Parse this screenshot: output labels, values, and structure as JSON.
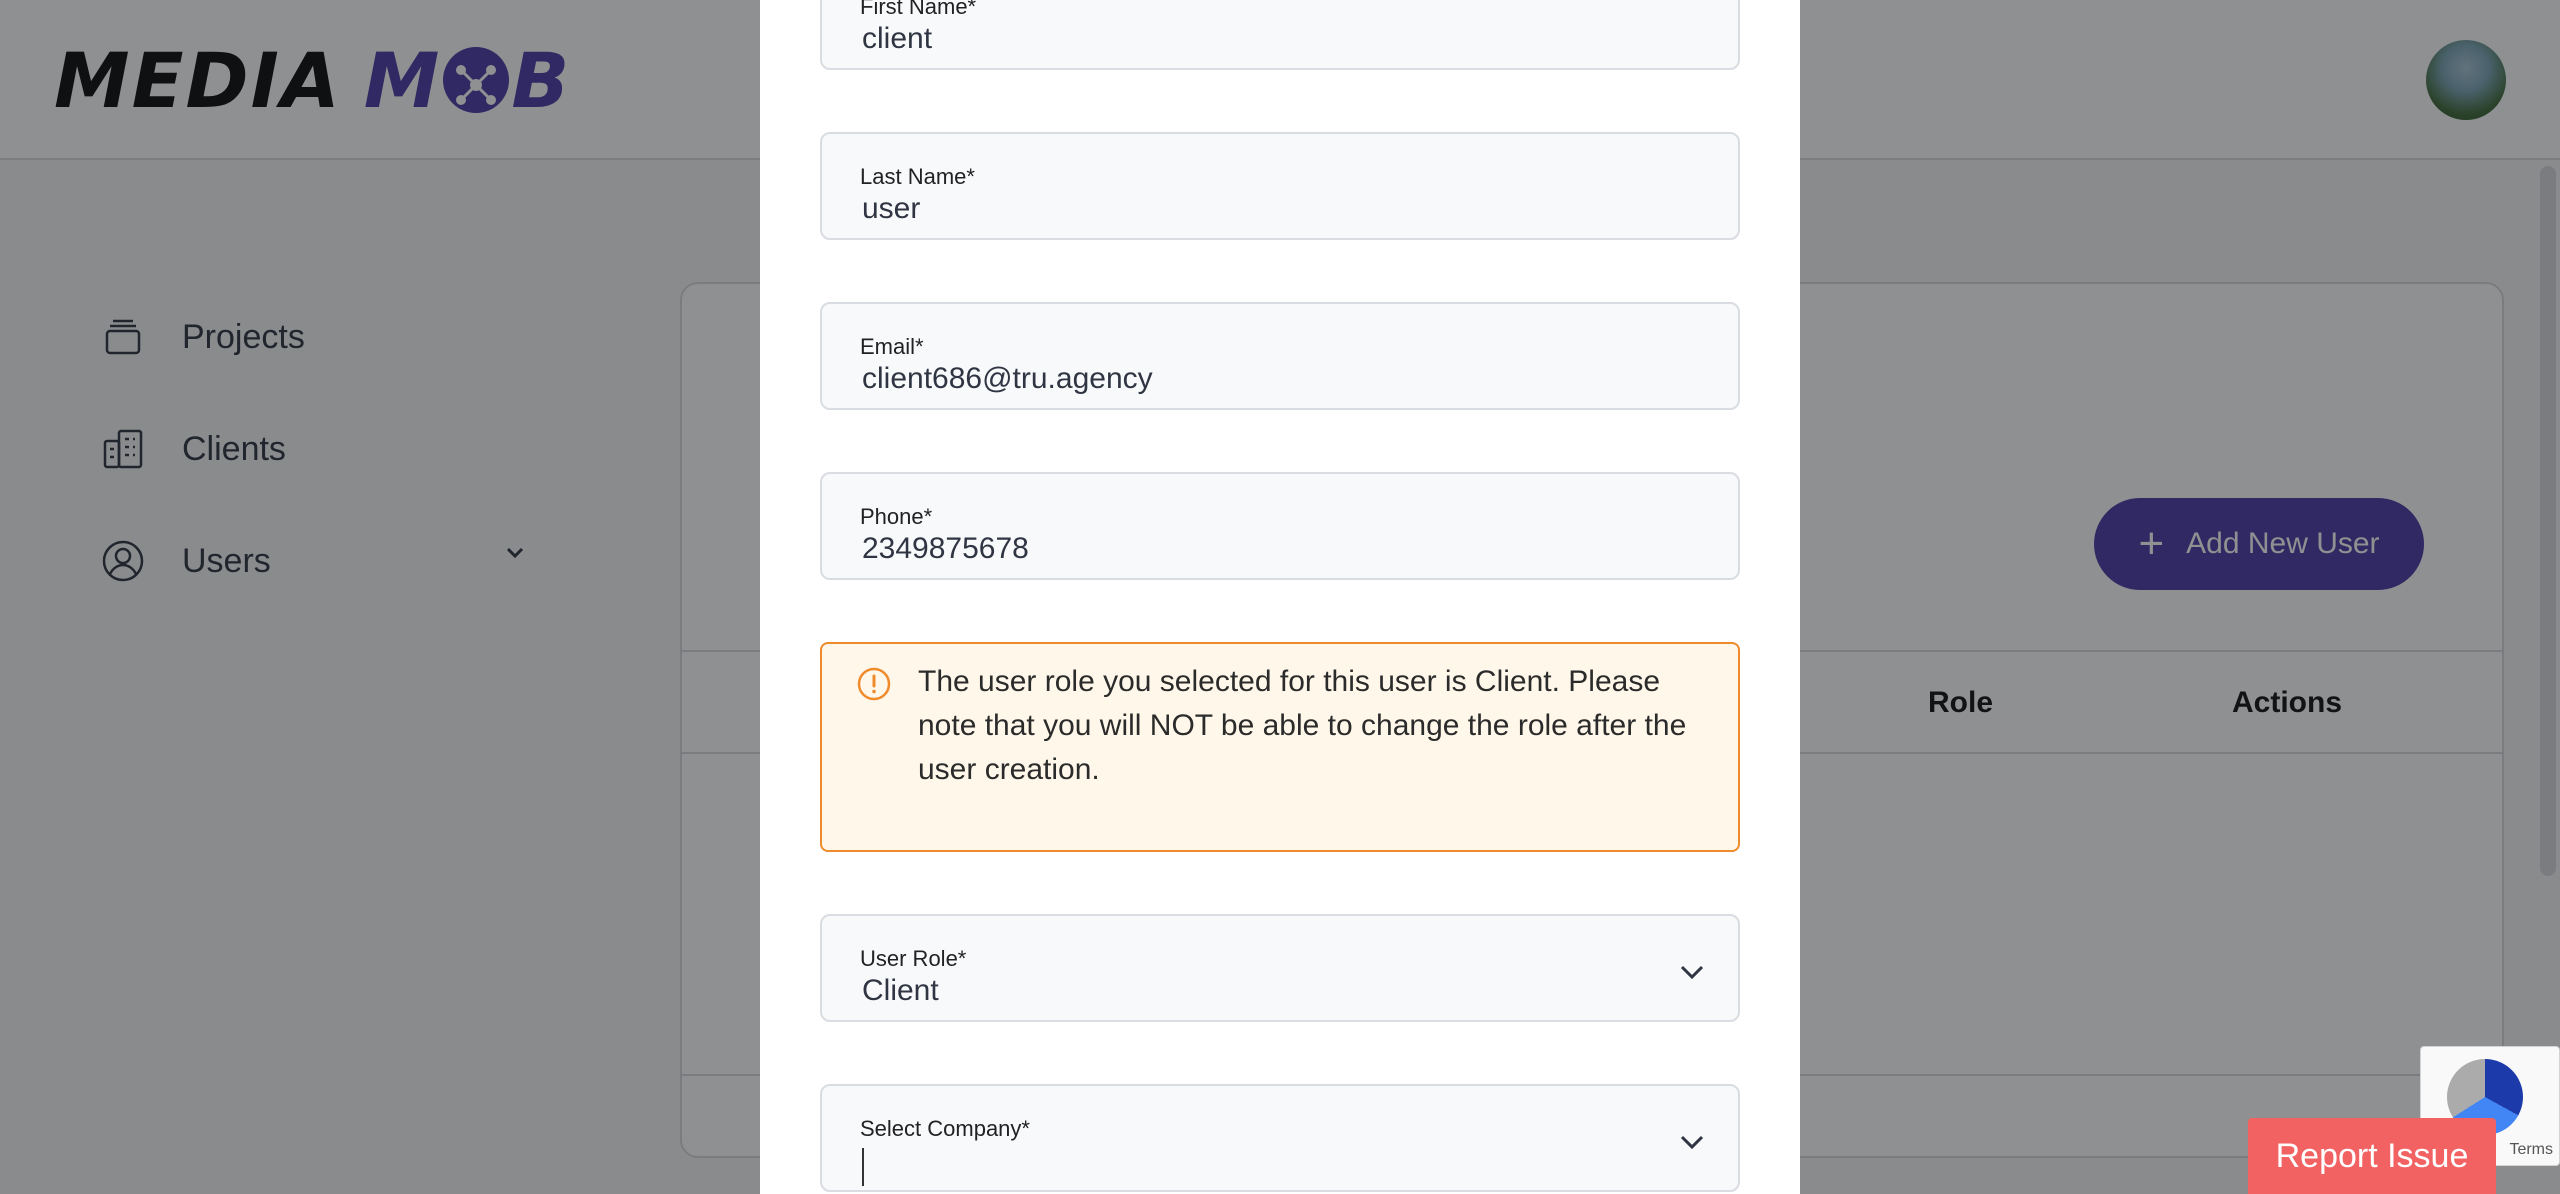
{
  "brand": {
    "word1": "MEDIA",
    "word2_prefix": "M",
    "word2_suffix": "B"
  },
  "sidebar": {
    "items": [
      {
        "label": "Projects",
        "icon": "stack-icon"
      },
      {
        "label": "Clients",
        "icon": "building-icon"
      },
      {
        "label": "Users",
        "icon": "user-circle-icon"
      }
    ]
  },
  "main": {
    "add_button": {
      "label": "Add New User",
      "icon": "plus-icon"
    },
    "table_headers": [
      "Role",
      "Actions"
    ]
  },
  "form": {
    "first_name": {
      "label": "First Name*",
      "value": "client"
    },
    "last_name": {
      "label": "Last Name*",
      "value": "user"
    },
    "email": {
      "label": "Email*",
      "value": "client686@tru.agency"
    },
    "phone": {
      "label": "Phone*",
      "value": "2349875678"
    },
    "warning": {
      "text": "The user role you selected for this user is Client. Please note that you will NOT be able to change the role after the user creation.",
      "icon": "alert-circle-icon"
    },
    "user_role": {
      "label": "User Role*",
      "value": "Client"
    },
    "company": {
      "label": "Select Company*",
      "value": ""
    }
  },
  "recaptcha": {
    "terms": "Terms"
  },
  "report_button": {
    "label": "Report Issue"
  },
  "colors": {
    "brand_purple": "#4a3aa7",
    "warning_border": "#ef8b2c",
    "warning_bg": "#fff7ea",
    "report_red": "#f26262"
  }
}
